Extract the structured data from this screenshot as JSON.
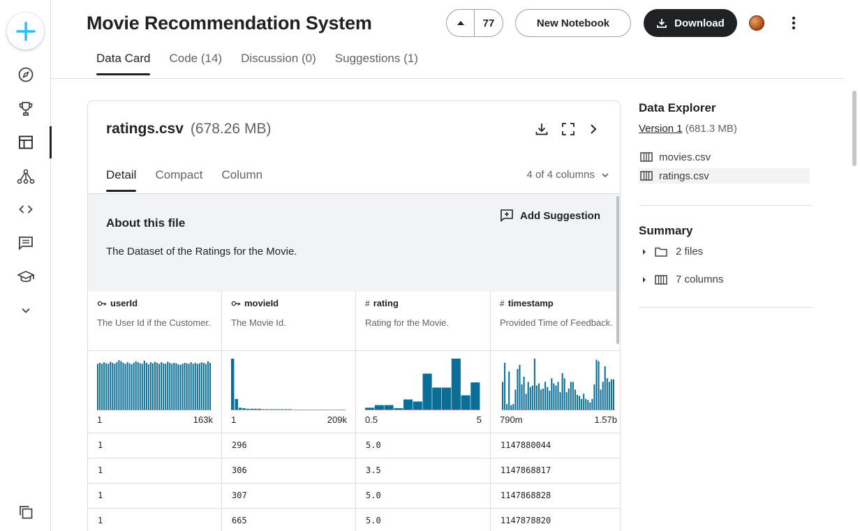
{
  "header": {
    "title": "Movie Recommendation System",
    "votes": "77",
    "new_notebook": "New Notebook",
    "download": "Download"
  },
  "tabs": [
    {
      "label": "Data Card",
      "active": true
    },
    {
      "label": "Code (14)"
    },
    {
      "label": "Discussion (0)"
    },
    {
      "label": "Suggestions (1)"
    }
  ],
  "file": {
    "name": "ratings.csv",
    "size": "(678.26 MB)",
    "subtabs": [
      "Detail",
      "Compact",
      "Column"
    ],
    "column_count": "4 of 4 columns",
    "about_title": "About this file",
    "about_text": "The Dataset of the Ratings for the Movie.",
    "add_suggestion": "Add Suggestion"
  },
  "columns": [
    {
      "name": "userId",
      "type": "key",
      "desc": "The User Id if the Customer.",
      "min": "1",
      "max": "163k",
      "bars": [
        0.9,
        0.92,
        0.9,
        0.93,
        0.91,
        0.9,
        0.94,
        0.92,
        0.9,
        0.93,
        0.97,
        0.95,
        0.92,
        0.9,
        0.93,
        0.91,
        0.89,
        0.92,
        0.95,
        0.93,
        0.91,
        0.9,
        0.96,
        0.92,
        0.89,
        0.93,
        0.91,
        0.94,
        0.92,
        0.9,
        0.93,
        0.91,
        0.9,
        0.94,
        0.92,
        0.9,
        0.92,
        0.91,
        0.89,
        0.88,
        0.9,
        0.92,
        0.91,
        0.9,
        0.93,
        0.9,
        0.92,
        0.9,
        0.91,
        0.93,
        0.92,
        0.9,
        0.95,
        0.92
      ]
    },
    {
      "name": "movieId",
      "type": "key",
      "desc": "The Movie Id.",
      "min": "1",
      "max": "209k",
      "bars": [
        1.0,
        0.22,
        0.05,
        0.04,
        0.03,
        0.03,
        0.03,
        0.03,
        0.02,
        0.02,
        0.02,
        0.02,
        0.02,
        0.02,
        0.02,
        0.02,
        0.01,
        0.01,
        0.01,
        0.01,
        0.01,
        0.01,
        0.01,
        0.01,
        0.01,
        0.01,
        0.01,
        0.01,
        0.01,
        0.01
      ]
    },
    {
      "name": "rating",
      "type": "number",
      "desc": "Rating for the Movie.",
      "min": "0.5",
      "max": "5",
      "bars": [
        0.05,
        0.1,
        0.1,
        0.04,
        0.21,
        0.17,
        0.71,
        0.44,
        0.44,
        1.0,
        0.29,
        0.54
      ]
    },
    {
      "name": "timestamp",
      "type": "number",
      "desc": "Provided Time of Feedback.",
      "min": "790m",
      "max": "1.57b",
      "bars": [
        0.55,
        0.92,
        0.12,
        0.75,
        0.1,
        0.12,
        0.4,
        0.8,
        0.88,
        0.5,
        0.65,
        0.32,
        0.55,
        0.45,
        0.48,
        1.0,
        0.48,
        0.52,
        0.4,
        0.42,
        0.55,
        0.45,
        0.38,
        0.62,
        0.52,
        0.48,
        0.55,
        0.35,
        0.72,
        0.62,
        0.35,
        0.42,
        0.55,
        0.55,
        0.4,
        0.3,
        0.28,
        0.22,
        0.32,
        0.22,
        0.2,
        0.15,
        0.22,
        0.5,
        0.98,
        0.95,
        0.4,
        0.55,
        0.85,
        0.62,
        0.55,
        0.6,
        0.6
      ]
    }
  ],
  "rows": [
    [
      "1",
      "296",
      "5.0",
      "1147880044"
    ],
    [
      "1",
      "306",
      "3.5",
      "1147868817"
    ],
    [
      "1",
      "307",
      "5.0",
      "1147868828"
    ],
    [
      "1",
      "665",
      "5.0",
      "1147878820"
    ]
  ],
  "explorer": {
    "title": "Data Explorer",
    "version_link": "Version 1",
    "version_size": "(681.3 MB)",
    "files": [
      {
        "name": "movies.csv"
      },
      {
        "name": "ratings.csv",
        "selected": true
      }
    ],
    "summary_title": "Summary",
    "summary": [
      {
        "label": "2 files",
        "icon": "folder-icon"
      },
      {
        "label": "7 columns",
        "icon": "table-icon"
      }
    ]
  },
  "colors": {
    "accent": "#20beff",
    "bar": "#0b6e99",
    "dark": "#202124"
  }
}
